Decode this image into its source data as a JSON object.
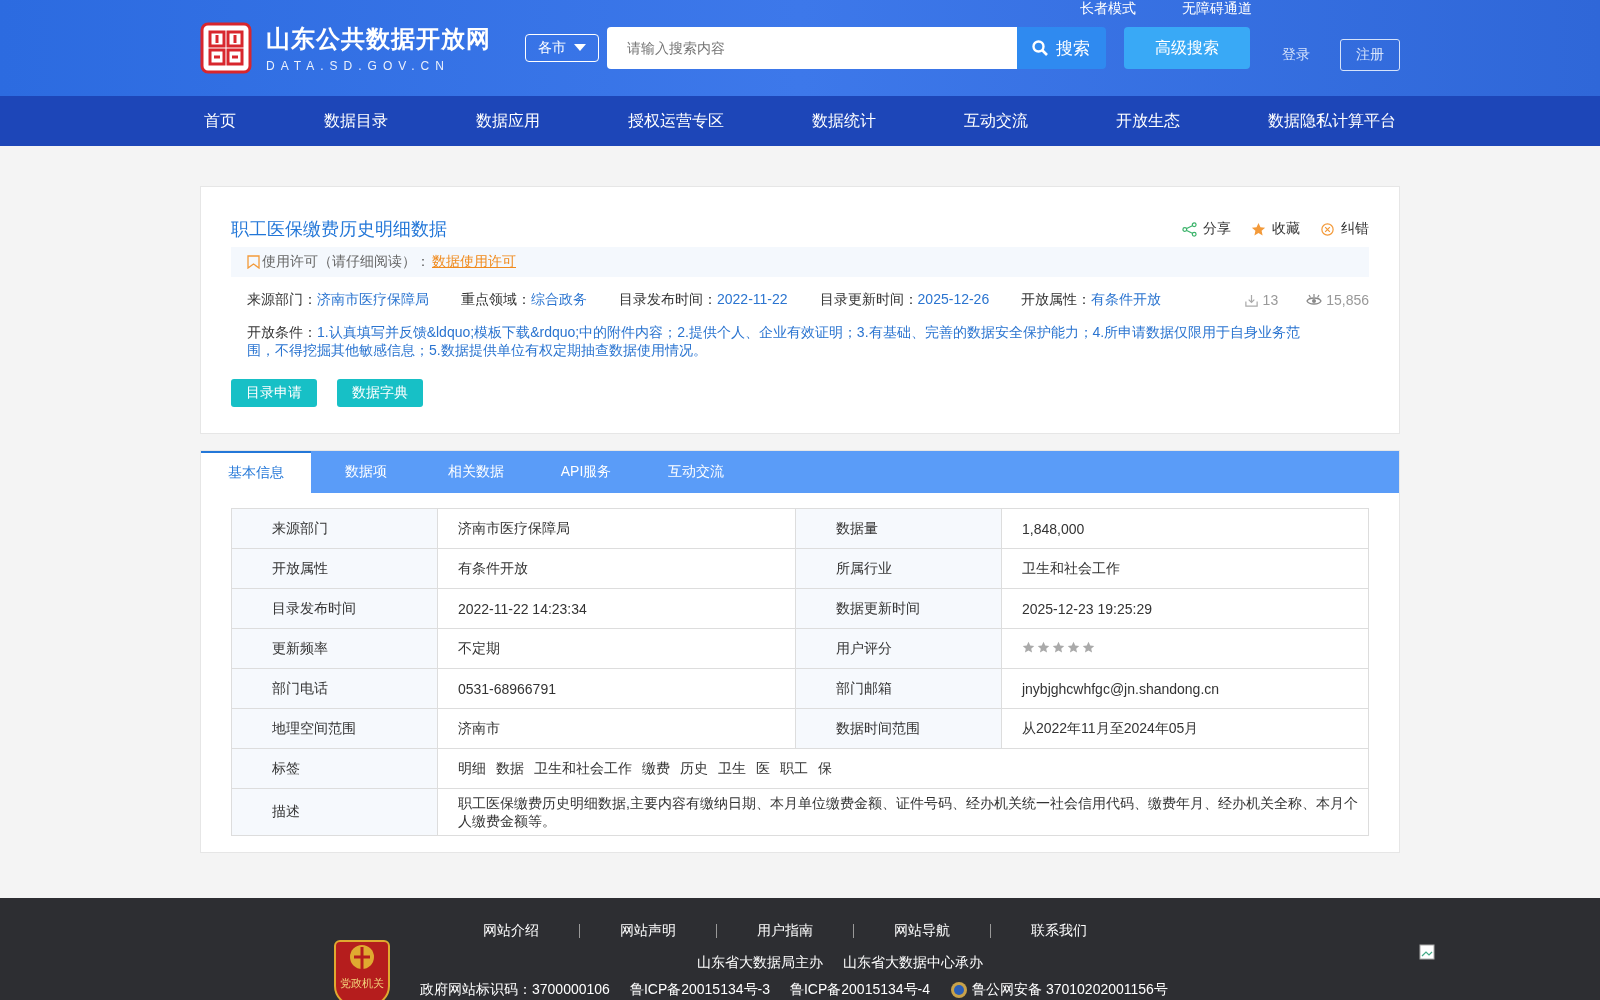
{
  "header": {
    "site_name": "山东公共数据开放网",
    "site_domain": "DATA.SD.GOV.CN",
    "top_links": [
      "长者模式",
      "无障碍通道"
    ],
    "city_select": "各市",
    "search": {
      "placeholder": "请输入搜索内容",
      "button": "搜索"
    },
    "advanced_search": "高级搜索",
    "login": "登录",
    "register": "注册"
  },
  "nav": [
    {
      "label": "首页",
      "selected": false
    },
    {
      "label": "数据目录",
      "selected": false
    },
    {
      "label": "数据应用",
      "selected": false
    },
    {
      "label": "授权运营专区",
      "selected": false
    },
    {
      "label": "数据统计",
      "selected": false
    },
    {
      "label": "互动交流",
      "selected": false
    },
    {
      "label": "开放生态",
      "selected": false
    },
    {
      "label": "数据隐私计算平台",
      "selected": false
    }
  ],
  "dataset": {
    "title": "职工医保缴费历史明细数据",
    "actions": [
      {
        "kind": "share",
        "label": "分享"
      },
      {
        "kind": "favorite",
        "label": "收藏"
      },
      {
        "kind": "report",
        "label": "纠错"
      }
    ],
    "license_label": "使用许可（请仔细阅读）：",
    "license_link": "数据使用许可",
    "meta": [
      {
        "label": "来源部门：",
        "value": "济南市医疗保障局"
      },
      {
        "label": "重点领域：",
        "value": "综合政务"
      },
      {
        "label": "目录发布时间：",
        "value": "2022-11-22"
      },
      {
        "label": "目录更新时间：",
        "value": "2025-12-26"
      },
      {
        "label": "开放属性：",
        "value": "有条件开放"
      }
    ],
    "downloads": "13",
    "views": "15,856",
    "conditions_label": "开放条件：",
    "conditions": "1.认真填写并反馈&ldquo;模板下载&rdquo;中的附件内容；2.提供个人、企业有效证明；3.有基础、完善的数据安全保护能力；4.所申请数据仅限用于自身业务范围，不得挖掘其他敏感信息；5.数据提供单位有权定期抽查数据使用情况。",
    "buttons": [
      "目录申请",
      "数据字典"
    ]
  },
  "tabs": [
    {
      "label": "基本信息",
      "selected": true
    },
    {
      "label": "数据项",
      "selected": false
    },
    {
      "label": "相关数据",
      "selected": false
    },
    {
      "label": "API服务",
      "selected": false
    },
    {
      "label": "互动交流",
      "selected": false
    }
  ],
  "info_rows": [
    {
      "label": "来源部门",
      "value": "济南市医疗保障局",
      "label_2": "数据量",
      "value_2": "1,848,000"
    },
    {
      "label": "开放属性",
      "value": "有条件开放",
      "label_2": "所属行业",
      "value_2": "卫生和社会工作"
    },
    {
      "label": "目录发布时间",
      "value": "2022-11-22 14:23:34",
      "label_2": "数据更新时间",
      "value_2": "2025-12-23 19:25:29"
    },
    {
      "label": "更新频率",
      "value": "不定期",
      "label_2": "用户评分",
      "stars": 0
    },
    {
      "label": "部门电话",
      "value": "0531-68966791",
      "label_2": "部门邮箱",
      "value_2": "jnybjghcwhfgc@jn.shandong.cn"
    },
    {
      "label": "地理空间范围",
      "value": "济南市",
      "label_2": "数据时间范围",
      "value_2": "从2022年11月至2024年05月"
    },
    {
      "label": "标签",
      "tags": [
        "明细",
        "数据",
        "卫生和社会工作",
        "缴费",
        "历史",
        "卫生",
        "医",
        "职工",
        "保"
      ]
    },
    {
      "label": "描述",
      "value": "职工医保缴费历史明细数据,主要内容有缴纳日期、本月单位缴费金额、证件号码、经办机关统一社会信用代码、缴费年月、经办机关全称、本月个人缴费金额等。"
    }
  ],
  "footer": {
    "links": [
      "网站介绍",
      "网站声明",
      "用户指南",
      "网站导航",
      "联系我们"
    ],
    "emblem_label": "党政机关",
    "sponsors": [
      "山东省大数据局主办",
      "山东省大数据中心承办"
    ],
    "records": [
      "政府网站标识码：3700000106",
      "鲁ICP备20015134号-3",
      "鲁ICP备20015134号-4",
      "鲁公网安备 37010202001156号"
    ]
  }
}
